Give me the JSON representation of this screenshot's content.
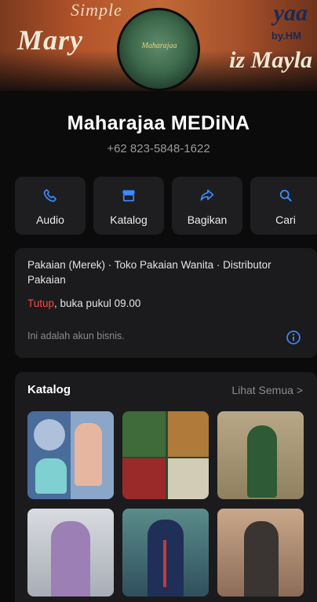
{
  "cover": {
    "line1": "Simple",
    "line2": "Mary",
    "right1": "yaa",
    "right_sub": "by.HM",
    "right2": "iz Mayla"
  },
  "avatar": {
    "logo_text": "Maharajaa"
  },
  "profile": {
    "name": "Maharajaa MEDiNA",
    "phone": "+62 823-5848-1622"
  },
  "actions": [
    {
      "label": "Audio",
      "icon": "phone-icon"
    },
    {
      "label": "Katalog",
      "icon": "storefront-icon"
    },
    {
      "label": "Bagikan",
      "icon": "share-icon"
    },
    {
      "label": "Cari",
      "icon": "search-icon"
    }
  ],
  "info": {
    "categories": "Pakaian (Merek) · Toko Pakaian Wanita · Distributor Pakaian",
    "status_closed": "Tutup",
    "status_rest": ", buka pukul 09.00",
    "note": "Ini adalah akun bisnis."
  },
  "catalog": {
    "title": "Katalog",
    "see_all": "Lihat Semua",
    "see_all_arrow": ">"
  },
  "colors": {
    "accent": "#3b8cff",
    "closed": "#ff453a",
    "card": "#1b1b1e",
    "background": "#0b0b0c"
  }
}
